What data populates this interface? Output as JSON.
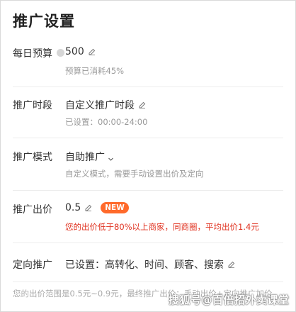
{
  "page": {
    "title": "推广设置"
  },
  "budget": {
    "label": "每日预算",
    "value": "500",
    "note": "预算已消耗45%"
  },
  "schedule": {
    "label": "推广时段",
    "value": "自定义推广时段",
    "note": "已设置：00:00-24:00"
  },
  "mode": {
    "label": "推广模式",
    "value": "自助推广",
    "note": "自定义模式，需要手动设置出价及定向"
  },
  "bid": {
    "label": "推广出价",
    "value": "0.5",
    "badge": "NEW",
    "warning": "您的出价低于80%以上商家，同商圈，平均出价1.4元"
  },
  "targeting": {
    "label": "定向推广",
    "value": "已设置：高转化、时间、顾客、搜索"
  },
  "footer": {
    "text": "您的出价范围是0.5元~0.9元，最终推广出价：手动出价+定向推广加价"
  },
  "watermark": {
    "text": "搜狐号@百倍招外卖课堂"
  },
  "icons": {
    "edit": "edit-icon",
    "help": "help-icon",
    "dropdown": "chevron-down-icon"
  },
  "colors": {
    "warning": "#e0301e",
    "badge": "#ff6a2b"
  }
}
